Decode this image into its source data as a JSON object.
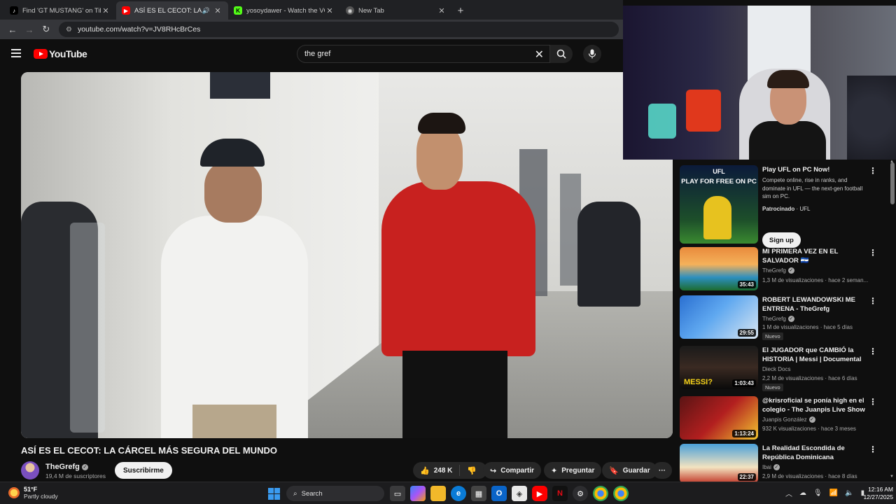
{
  "browser": {
    "tabs": [
      {
        "title": "Find 'GT MUSTANG' on TikTok |",
        "favicon": "tiktok-icon",
        "active": false
      },
      {
        "title": "ASÍ ES EL CECOT: LA CÁRCE",
        "favicon": "youtube-icon",
        "active": true
      },
      {
        "title": "yosoydawer - Watch the VOD o",
        "favicon": "kick-icon",
        "active": false
      },
      {
        "title": "New Tab",
        "favicon": "chrome-icon",
        "active": false
      }
    ],
    "new_tab": "+",
    "url": "youtube.com/watch?v=JV8RHcBrCes"
  },
  "youtube": {
    "logo_text": "YouTube",
    "search_value": "the gref",
    "video": {
      "title": "ASÍ ES EL CECOT: LA CÁRCEL MÁS SEGURA DEL MUNDO",
      "channel": "TheGrefg",
      "subscribers": "19,4 M de suscriptores",
      "subscribe_label": "Suscribirme",
      "likes": "248 K",
      "share_label": "Compartir",
      "ask_label": "Preguntar",
      "save_label": "Guardar",
      "more_label": "···"
    },
    "ad": {
      "thumb_heading": "UFL",
      "thumb_subheading": "PLAY FOR FREE ON PC",
      "title": "Play UFL on PC Now!",
      "description": "Compete online, rise in ranks, and dominate in UFL — the next-gen football sim on PC.",
      "sponsored": "Patrocinado",
      "advertiser": "UFL",
      "cta": "Sign up"
    },
    "recommendations": [
      {
        "title": "MI PRIMERA VEZ EN EL SALVADOR 🇸🇻",
        "channel": "TheGrefg",
        "verified": true,
        "views": "1,3 M de visualizaciones",
        "age": "hace 2 seman...",
        "duration": "35:43",
        "badge": ""
      },
      {
        "title": "ROBERT LEWANDOWSKI ME ENTRENA - TheGrefg",
        "channel": "TheGrefg",
        "verified": true,
        "views": "1 M de visualizaciones",
        "age": "hace 5 días",
        "duration": "29:55",
        "badge": "Nuevo"
      },
      {
        "title": "El JUGADOR que CAMBIÓ la HISTORIA | Messi | Documental",
        "channel": "Dieck Docs",
        "verified": false,
        "views": "2,2 M de visualizaciones",
        "age": "hace 6 días",
        "duration": "1:03:43",
        "badge": "Nuevo"
      },
      {
        "title": "@krisroficial se ponía high en el colegio - The Juanpis Live Show",
        "channel": "Juanpis González",
        "verified": true,
        "views": "932 K visualizaciones",
        "age": "hace 3 meses",
        "duration": "1:13:24",
        "badge": ""
      },
      {
        "title": "La Realidad Escondida de República Dominicana",
        "channel": "Ibai",
        "verified": true,
        "views": "2,9 M de visualizaciones",
        "age": "hace 8 días",
        "duration": "22:37",
        "badge": ""
      }
    ]
  },
  "taskbar": {
    "temperature": "51°F",
    "condition": "Partly cloudy",
    "search_label": "Search",
    "time": "12:16 AM",
    "date": "12/27/2025"
  },
  "colors": {
    "youtube_red": "#ff0000",
    "bg": "#0f0f0f",
    "tab_active": "#35363a"
  }
}
